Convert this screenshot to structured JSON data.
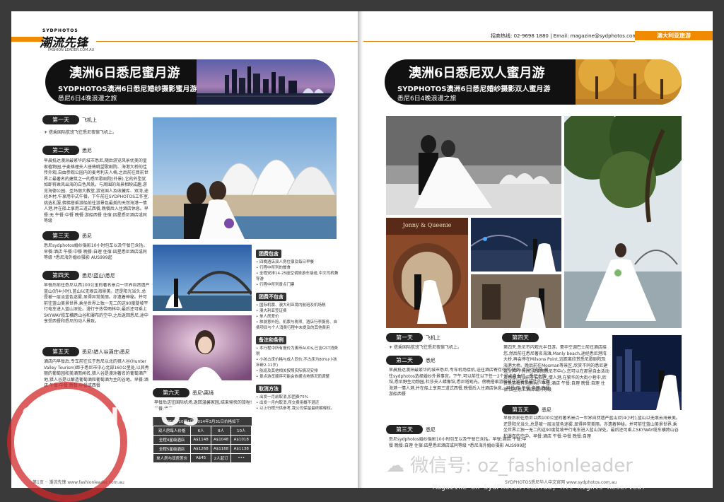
{
  "left": {
    "logo_top": "SYDPHOTOS",
    "logo_main": "潮流先锋",
    "logo_sub": "FASHION LEADER.COM.AU",
    "banner_title": "澳洲6日悉尼蜜月游",
    "banner_sub": "SYDPHOTOS澳洲6日悉尼婚纱摄影蜜月游(团购)",
    "banner_sub2": "悉尼6日4晚浪漫之旅",
    "days": [
      {
        "label": "第一天",
        "route": "飞机上",
        "text": "搭乘国际航班飞往悉尼夜宿飞机上。"
      },
      {
        "label": "第二天",
        "route": "悉尼",
        "text": "早晨抵达澳洲最繁华的城市悉尼,随后游览风景优美的皇家植物园,于麦格理夫人座椅眺望歌剧院、海港大桥的佳传外观,自由参观公园内的麦考利夫人椅,之后前往目前世界上最著名的建筑之一的悉尼歌剧院(外景),它的外型犹如即将乘风出海的白色风帆。与周围的海景相映成趣,游览海德公园、圣玛丽大教堂,游览国人及收藏库、双湾,途经乡村,午享用中式午餐。下午前往SYDPHOTOS工作室,挑选礼服,佛佛搭乘游船前往游景色最美的天然海港一情人港,并在船上享用三道式西餐,晚餐后入住酒店休息。早餐:无 午餐:中餐 晚餐:游船西餐 住宿:四星悉尼酒店或同等级"
      },
      {
        "label": "第三天",
        "route": "悉尼",
        "text": "悉尼sydphotos婚纱摄影10小时包车以及午餐已含括。早餐:酒店 午餐:中餐 晚餐:自理 住宿:四星悉尼酒店或同等级 *悉尼海外婚纱摄影 AUS999起"
      },
      {
        "label": "第四天",
        "route": "悉尼\\蓝山\\悉尼",
        "text": "早餐后前往悉尼以西100公里的著名景点一世界自然遗产蓝山(约4小时),蓝山以无垠云海景美。还是阳光当头,总是被一层淡蓝色迷雾,显得异常美丽。亦遗着神秘。并可前往蓝山美景世界,乘坐世界上独一无二的这90度陡坡平行电车进入蓝山深处。漫行于热带雨林中,最后还可乘上SKYWAY缆车横跨山谷和瀑布的空中,之后返回悉尼,途中享受西餐和悉尼的动人景致。"
      },
      {
        "label": "第五天",
        "route": "悉尼\\猎人谷酒庄\\悉尼",
        "text": "酒店内早餐后,专车前往位于悉尼以北的猎人谷(Hunter Valley Tourism)距于悉尼市中心北部160公里处,以其秀丽的葡萄园和美酒而闻名,猎人谷是澳洲著名的葡萄酒产地,猎人谷是以酿造葡萄酒和葡萄酒为主的谷地。早餐:酒店 午餐:中餐 晚餐:中餐或西餐"
      },
      {
        "label": "第六天",
        "route": "悉尼\\离境",
        "text": "早餐后送往国际机场,返回温馨家园,结束愉快的旅程! 早餐:酒店"
      }
    ],
    "sidebar": [
      {
        "heading": "团费包含",
        "items": [
          "四晚酒店双人房住宿及每日早餐",
          "行程中所列的餐食",
          "全程安排14-25座空调旅游车接送,中文司机兼导游",
          "行程中所列景点门票"
        ]
      },
      {
        "heading": "团费不包含",
        "items": [
          "国际机票、澳大利亚境内航班及机场税",
          "澳大利亚签证费",
          "单人房差价",
          "旅游意外险、机票与税项、酒店行李服务、自费项目与个人消费行程中未提及的其他费用"
        ]
      },
      {
        "heading": "备注和条例",
        "items": [
          "本行程中所有报价为澳币AUD$,已含GST消费税",
          "小孩占床价格与成人同价,不占床为80%(小孩年龄2-11岁)",
          "航班及其他相关按照实际情况安排",
          "景点游览顺序可能会依据当地情况而调整"
        ]
      },
      {
        "heading": "取消方法",
        "items": [
          "出发一月前取消,扣团费75%",
          "出发一月内取消,所交费用概不退还",
          "以上行程只供参考,我公司保留最终解释权。"
        ]
      }
    ],
    "price_table": {
      "title": "2013年10月1日-2014年3月31日价格如下",
      "headers": [
        "双人房每人价格",
        "6人",
        "8人",
        "10人"
      ],
      "rows": [
        [
          "全程4星级酒店",
          "A$1148",
          "A$1048",
          "A$1018"
        ],
        [
          "全程5星级酒店",
          "A$1268",
          "A$1168",
          "A$1138"
        ],
        [
          "单人房与双房差价",
          "A$45",
          "2人起订",
          "•••"
        ]
      ]
    },
    "footer": "第1页 ·· 潮流先锋 www.fashionleader.com.au"
  },
  "right": {
    "contact": "招商热线: 02-9698 1880  |  Email: magazine@sydphotos.com.au",
    "section_tag": "澳大利亚旅游",
    "banner_title": "澳洲6日悉尼双人蜜月游",
    "banner_sub": "SYDPHOTOS澳洲6日悉尼婚纱摄影双人蜜月游",
    "banner_sub2": "悉尼6日4晚浪漫之旅",
    "shop_sign": "Jonny & Queenie",
    "days": [
      {
        "label": "第一天",
        "route": "飞机上",
        "text": "搭乘国际航班飞往悉尼夜宿飞机上。"
      },
      {
        "label": "第二天",
        "route": "悉尼",
        "text": "早晨抵达澳洲最繁华的城市悉尼,专车机场接机,送往酒店寄存行李,随后,请自行安排,前往sydphotos选择婚纱外景事宜。下午,可以前往以下任一2个景点自由行。悉尼水族馆,悉尼野生动物园,杜莎夫人蜡像馆,悉尼塔观光。傍晚搭乘游船前往游景色最佳的天然海港一情人港,并在船上享用三道式西餐,晚餐后入住酒店休息。早餐:无 午餐:自理 晚餐:游船西餐"
      },
      {
        "label": "第三天",
        "route": "悉尼",
        "text": "悉尼sydphotos婚纱摄影10小时包车以及午餐已含括。早餐:酒店 午餐:中餐 晚餐:自理 住宿:四星悉尼酒店或同等级 *悉尼海外婚纱摄影 AUS999起"
      },
      {
        "label": "第四天",
        "route": "悉尼市内观光半日游(随团观光)",
        "text": "第四天,悉尼市内观光半日游。豪华空调巴士前往酒店接您,然后前往悉尼著名海滩,Manly beach,途经悉尼港湾大桥,再会停在Milsons Point,远距离欣赏悉尼歌剧院及海港大桥。晚后前往Mosman等景区,欣赏不同的悉尼建筑,约中午时间,阅读回悉尼市中心,您可以在那里自由活动及用餐,可以前往岩石区,情人港,在繁华的大街小巷中,欣赏悉尼独有的魅力。早餐:酒店 午餐:自理 晚餐:自理 住宿:四星悉尼酒店或同等级"
      },
      {
        "label": "第五天",
        "route": "悉尼",
        "text": "早餐后前往悉尼以西100公里的著名景点一世界自然遗产蓝山(约4小时),蓝山以无垠云海景美。还是阳光当头,总是被一层淡蓝色迷雾,显得异常美丽。亦遗着神秘。并可前往蓝山美景世界,乘坐世界上独一无二的这90度陡坡平行电车进入蓝山深处。最后还可乘上SKYWAY缆车横跨山谷和瀑布的空中。早餐:酒店 午餐:中餐 晚餐:自理"
      }
    ],
    "footer": "SYDPHOTOS悉尼华人中文官网 www.sydphotos.com.au"
  },
  "watermark": {
    "text1": "SYDPHOTOS",
    "text2": "SYDPHOTOS.COM.AU"
  },
  "wechat": "微信号: oz_fashionleader",
  "copyright": "Magazine on SydPhotos.com.au, All Rights Reserved."
}
